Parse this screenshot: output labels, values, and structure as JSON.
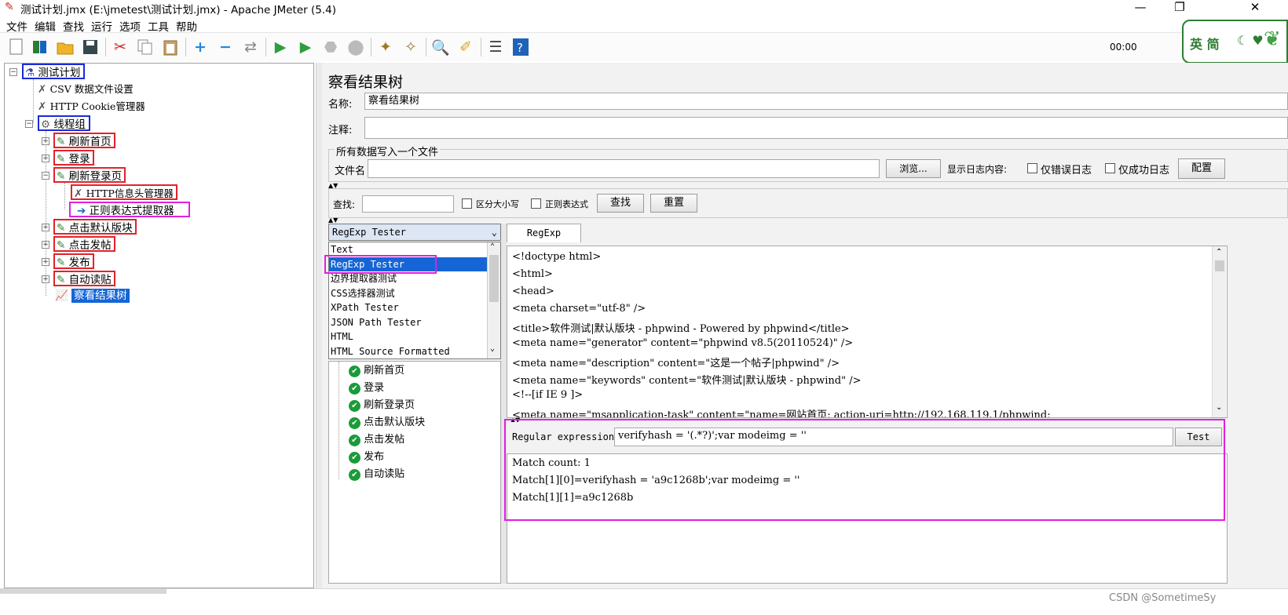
{
  "window": {
    "title": "测试计划.jmx (E:\\jmetest\\测试计划.jmx) - Apache JMeter (5.4)",
    "minimize": "—",
    "maximize": "❐",
    "close": "✕"
  },
  "menu": [
    "文件",
    "编辑",
    "查找",
    "运行",
    "选项",
    "工具",
    "帮助"
  ],
  "toolbar": {
    "timer": "00:00",
    "icons": [
      "new-icon",
      "templates-icon",
      "open-icon",
      "save-icon",
      "cut-icon",
      "copy-icon",
      "paste-icon",
      "expand-icon",
      "collapse-icon",
      "toggle-icon",
      "start-icon",
      "start-no-pause-icon",
      "stop-icon",
      "shutdown-icon",
      "clear-icon",
      "clear-all-icon",
      "search-icon",
      "reset-search-icon",
      "function-helper-icon",
      "help-icon"
    ]
  },
  "ime": {
    "label": "英 简"
  },
  "tree": {
    "root": "测试计划",
    "csv": "CSV 数据文件设置",
    "cookie": "HTTP Cookie管理器",
    "threadgroup": "线程组",
    "samplers": [
      "刷新首页",
      "登录",
      "刷新登录页"
    ],
    "header_manager": "HTTP信息头管理器",
    "regex_extractor": "正则表达式提取器",
    "samplers2": [
      "点击默认版块",
      "点击发帖",
      "发布",
      "自动读贴"
    ],
    "listener": "察看结果树"
  },
  "panel": {
    "title": "察看结果树",
    "name_label": "名称:",
    "name_value": "察看结果树",
    "comment_label": "注释:",
    "comment_value": "",
    "group_title": "所有数据写入一个文件",
    "filename_label": "文件名",
    "filename_value": "",
    "browse": "浏览...",
    "log_label": "显示日志内容:",
    "errors_only": "仅错误日志",
    "success_only": "仅成功日志",
    "configure": "配置",
    "search_label": "查找:",
    "search_value": "",
    "case_sensitive": "区分大小写",
    "regex": "正则表达式",
    "find_button": "查找",
    "reset_button": "重置"
  },
  "renderer": {
    "selected": "RegExp Tester",
    "options": [
      "Text",
      "RegExp Tester",
      "边界提取器测试",
      "CSS选择器测试",
      "XPath Tester",
      "JSON Path Tester",
      "HTML",
      "HTML Source Formatted"
    ]
  },
  "results": [
    "刷新首页",
    "登录",
    "刷新登录页",
    "点击默认版块",
    "点击发帖",
    "发布",
    "自动读贴"
  ],
  "tab": {
    "label": "RegExp Tester"
  },
  "response_lines": [
    "<!doctype html>",
    "<html>",
    "<head>",
    "<meta charset=\"utf-8\" />",
    "<title>软件测试|默认版块 - phpwind - Powered by phpwind</title>",
    "<meta name=\"generator\" content=\"phpwind v8.5(20110524)\" />",
    "<meta name=\"description\" content=\"这是一个帖子|phpwind\" />",
    "<meta name=\"keywords\" content=\"软件测试|默认版块 - phpwind\" />",
    "<!--[if IE 9 ]>",
    "<meta name=\"msapplication-task\" content=\"name=网站首页; action-uri=http://192.168.119.1/phpwind;"
  ],
  "regex": {
    "label": "Regular expression:",
    "value": "verifyhash = '(.*?)';var modeimg = ''",
    "test_button": "Test"
  },
  "match_lines": [
    "Match count: 1",
    "Match[1][0]=verifyhash = 'a9c1268b';var modeimg = ''",
    "Match[1][1]=a9c1268b"
  ],
  "watermark": "CSDN @SometimeSy"
}
